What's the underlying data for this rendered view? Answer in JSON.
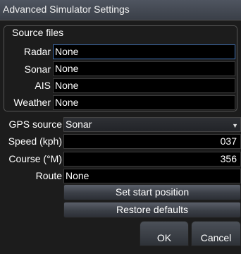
{
  "window": {
    "title": "Advanced Simulator Settings"
  },
  "source_files": {
    "group_label": "Source files",
    "rows": [
      {
        "label": "Radar",
        "value": "None"
      },
      {
        "label": "Sonar",
        "value": "None"
      },
      {
        "label": "AIS",
        "value": "None"
      },
      {
        "label": "Weather",
        "value": "None"
      }
    ]
  },
  "gps_source": {
    "label": "GPS source",
    "value": "Sonar"
  },
  "speed": {
    "label": "Speed (kph)",
    "value": "037"
  },
  "course": {
    "label": "Course (°M)",
    "value": "356"
  },
  "route": {
    "label": "Route",
    "value": "None"
  },
  "buttons": {
    "set_start": "Set start position",
    "restore": "Restore defaults",
    "ok": "OK",
    "cancel": "Cancel"
  },
  "colors": {
    "focus_border": "#3f6fb0",
    "field_bg": "#000000",
    "window_bg": "#1c1c1c"
  }
}
